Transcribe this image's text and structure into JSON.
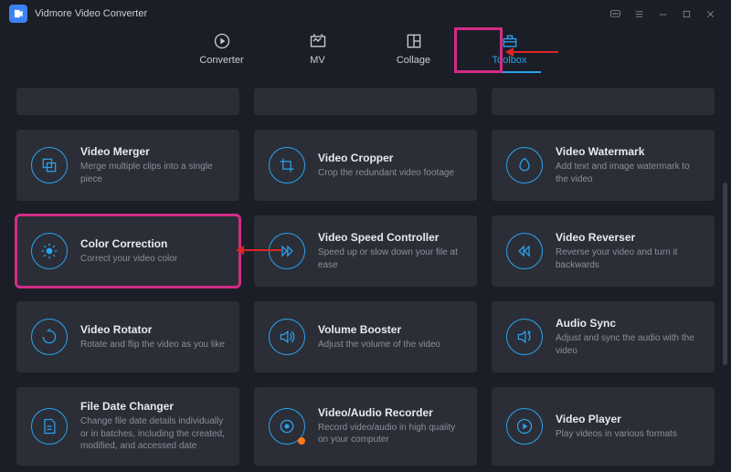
{
  "app": {
    "title": "Vidmore Video Converter"
  },
  "nav": {
    "tabs": [
      {
        "id": "converter",
        "label": "Converter"
      },
      {
        "id": "mv",
        "label": "MV"
      },
      {
        "id": "collage",
        "label": "Collage"
      },
      {
        "id": "toolbox",
        "label": "Toolbox"
      }
    ],
    "active": "toolbox"
  },
  "tools": {
    "row1": [
      {
        "id": "video-merger",
        "title": "Video Merger",
        "desc": "Merge multiple clips into a single piece"
      },
      {
        "id": "video-cropper",
        "title": "Video Cropper",
        "desc": "Crop the redundant video footage"
      },
      {
        "id": "video-watermark",
        "title": "Video Watermark",
        "desc": "Add text and image watermark to the video"
      }
    ],
    "row2": [
      {
        "id": "color-correction",
        "title": "Color Correction",
        "desc": "Correct your video color"
      },
      {
        "id": "video-speed-controller",
        "title": "Video Speed Controller",
        "desc": "Speed up or slow down your file at ease"
      },
      {
        "id": "video-reverser",
        "title": "Video Reverser",
        "desc": "Reverse your video and turn it backwards"
      }
    ],
    "row3": [
      {
        "id": "video-rotator",
        "title": "Video Rotator",
        "desc": "Rotate and flip the video as you like"
      },
      {
        "id": "volume-booster",
        "title": "Volume Booster",
        "desc": "Adjust the volume of the video"
      },
      {
        "id": "audio-sync",
        "title": "Audio Sync",
        "desc": "Adjust and sync the audio with the video"
      }
    ],
    "row4": [
      {
        "id": "file-date-changer",
        "title": "File Date Changer",
        "desc": "Change file date details individually or in batches, including the created, modified, and accessed date"
      },
      {
        "id": "video-audio-recorder",
        "title": "Video/Audio Recorder",
        "desc": "Record video/audio in high quality on your computer"
      },
      {
        "id": "video-player",
        "title": "Video Player",
        "desc": "Play videos in various formats"
      }
    ]
  },
  "annotations": {
    "highlight_tool": "color-correction",
    "highlight_tab": "toolbox"
  }
}
